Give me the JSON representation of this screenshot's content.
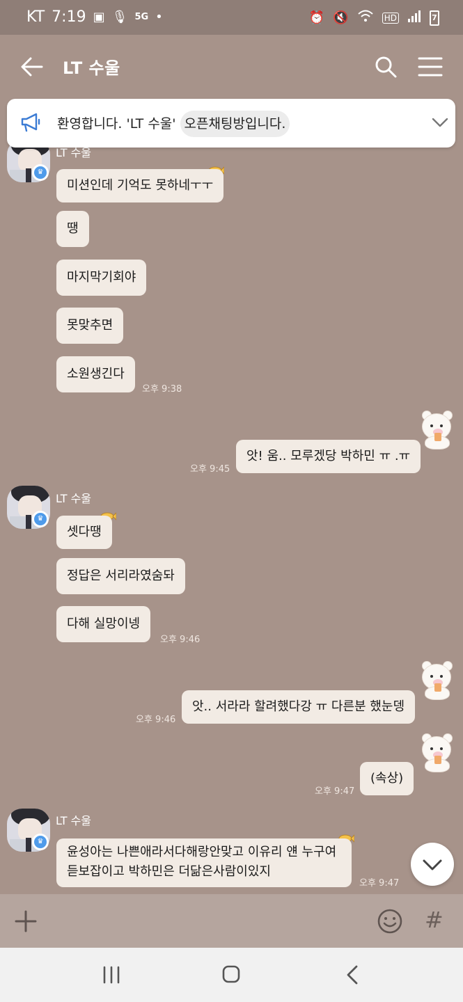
{
  "status_bar": {
    "carrier": "KT",
    "time": "7:19",
    "network": "5G",
    "battery": "7"
  },
  "app_bar": {
    "title": "LT 수울"
  },
  "notice": {
    "text_a": "환영합니다. 'LT 수울' ",
    "text_b": "오픈채팅방입니다."
  },
  "messages": [
    {
      "text": "미션인데 기억도 못하네ㅜㅜ"
    },
    {
      "text": "땡"
    },
    {
      "text": "마지막기회야"
    },
    {
      "text": "못맞추면"
    },
    {
      "text": "소원생긴다",
      "time": "오후 9:38"
    },
    {
      "text": "앗! 움.. 모루겠당 박하민 ㅠ .ㅠ",
      "time": "오후 9:45"
    },
    {
      "sender": "LT 수울",
      "text": "셋다땡"
    },
    {
      "text": "정답은 서리라였숨돠"
    },
    {
      "text": "다해 실망이넹",
      "time": "오후 9:46"
    },
    {
      "text": "앗.. 서라라 할려했다강 ㅠ 다른분 했눈뎅",
      "time": "오후 9:46"
    },
    {
      "text": "(속상)",
      "time": "오후 9:47"
    },
    {
      "sender": "LT 수울",
      "text": "윤성아는 나쁜애라서다해랑안맞고 이유리 얜 누구여 듣보잡이고 박하민은 더닮은사람이있지",
      "time": "오후 9:47"
    }
  ],
  "partial_sender": "LT 수울",
  "input": {
    "hash": "#"
  },
  "colors": {
    "background": "#a7938a",
    "bubble": "#f2ebe4",
    "badge": "#4f9bea"
  }
}
